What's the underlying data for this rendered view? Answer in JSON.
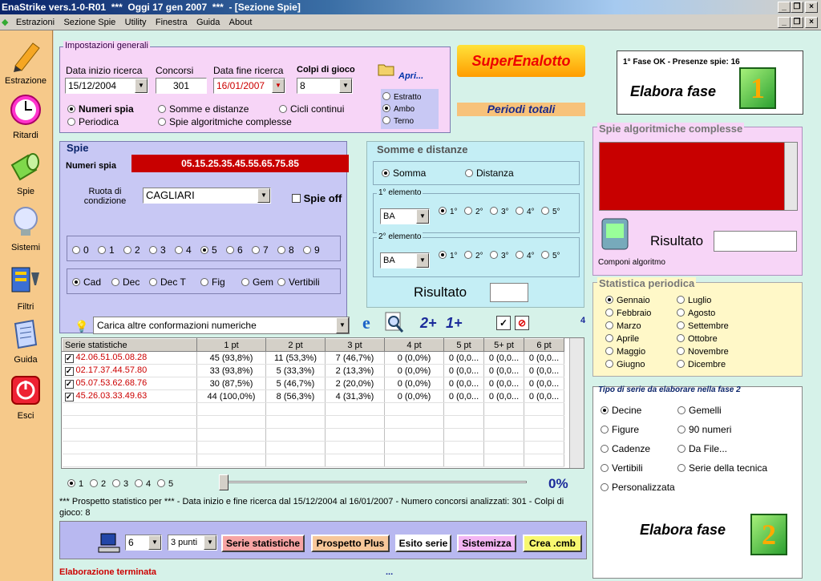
{
  "window": {
    "title": "EnaStrike vers.1-0-R01  ***  Oggi 17 gen 2007  ***  - [Sezione Spie]"
  },
  "menu": [
    "Estrazioni",
    "Sezione Spie",
    "Utility",
    "Finestra",
    "Guida",
    "About"
  ],
  "sidebar": [
    {
      "label": "Estrazione",
      "icon": "pencil-icon"
    },
    {
      "label": "Ritardi",
      "icon": "clock-icon"
    },
    {
      "label": "Spie",
      "icon": "flashlight-icon"
    },
    {
      "label": "Sistemi",
      "icon": "lightbulb-icon"
    },
    {
      "label": "Filtri",
      "icon": "filter-icon"
    },
    {
      "label": "Guida",
      "icon": "book-icon"
    },
    {
      "label": "Esci",
      "icon": "power-icon"
    }
  ],
  "impostazioni": {
    "legend": "Impostazioni generali",
    "data_inizio_label": "Data inizio ricerca",
    "data_inizio": "15/12/2004",
    "concorsi_label": "Concorsi",
    "concorsi": "301",
    "data_fine_label": "Data fine ricerca",
    "data_fine": "16/01/2007",
    "colpi_label": "Colpi di gioco",
    "colpi": "8",
    "apri": "Apri...",
    "options": [
      "Numeri spia",
      "Somme e distanze",
      "Cicli continui",
      "Periodica",
      "Spie algoritmiche complesse"
    ],
    "selected": "Numeri spia",
    "tipo": [
      "Estratto",
      "Ambo",
      "Terno"
    ],
    "tipo_selected": "Ambo"
  },
  "logo": {
    "text": "SuperEnalotto",
    "periodi": "Periodi totali"
  },
  "fase1": {
    "status": "1° Fase OK - Presenze spie: 16",
    "label": "Elabora fase",
    "num": "1"
  },
  "spie": {
    "legend": "Spie",
    "numeri_label": "Numeri spia",
    "numeri": "05.15.25.35.45.55.65.75.85",
    "ruota_label": "Ruota di condizione",
    "ruota": "CAGLIARI",
    "spie_off": "Spie off",
    "digits": [
      "0",
      "1",
      "2",
      "3",
      "4",
      "5",
      "6",
      "7",
      "8",
      "9"
    ],
    "digit_selected": "5",
    "tipi": [
      "Cad",
      "Dec",
      "Dec T",
      "Fig",
      "Gem",
      "Vertibili"
    ],
    "tipo_selected": "Cad",
    "carica": "Carica altre conformazioni numeriche"
  },
  "somme": {
    "legend": "Somme e distanze",
    "somma": "Somma",
    "distanza": "Distanza",
    "el1": "1° elemento",
    "el2": "2° elemento",
    "ruota1": "BA",
    "ruota2": "BA",
    "pos": [
      "1°",
      "2°",
      "3°",
      "4°",
      "5°"
    ],
    "risultato": "Risultato"
  },
  "toolbar": {
    "two_plus": "2+",
    "one_plus": "1+",
    "count": "4"
  },
  "algo": {
    "legend": "Spie algoritmiche complesse",
    "risultato": "Risultato",
    "componi": "Componi algoritmo"
  },
  "periodica": {
    "legend": "Statistica periodica",
    "months": [
      "Gennaio",
      "Febbraio",
      "Marzo",
      "Aprile",
      "Maggio",
      "Giugno",
      "Luglio",
      "Agosto",
      "Settembre",
      "Ottobre",
      "Novembre",
      "Dicembre"
    ],
    "selected": "Gennaio"
  },
  "tiposerie": {
    "legend": "Tipo di serie da elaborare nella fase 2",
    "options": [
      "Decine",
      "Gemelli",
      "Figure",
      "90 numeri",
      "Cadenze",
      "Da File...",
      "Vertibili",
      "Serie della tecnica",
      "Personalizzata"
    ],
    "selected": "Decine"
  },
  "fase2": {
    "label": "Elabora fase",
    "num": "2"
  },
  "table": {
    "headers": [
      "Serie statistiche",
      "1 pt",
      "2 pt",
      "3 pt",
      "4 pt",
      "5 pt",
      "5+ pt",
      "6 pt"
    ],
    "rows": [
      [
        "42.06.51.05.08.28",
        "45 (93,8%)",
        "11 (53,3%)",
        "7 (46,7%)",
        "0 (0,0%)",
        "0 (0,0...",
        "0 (0,0...",
        "0 (0,0..."
      ],
      [
        "02.17.37.44.57.80",
        "33 (93,8%)",
        "5 (33,3%)",
        "2 (13,3%)",
        "0 (0,0%)",
        "0 (0,0...",
        "0 (0,0...",
        "0 (0,0..."
      ],
      [
        "05.07.53.62.68.76",
        "30 (87,5%)",
        "5 (46,7%)",
        "2 (20,0%)",
        "0 (0,0%)",
        "0 (0,0...",
        "0 (0,0...",
        "0 (0,0..."
      ],
      [
        "45.26.03.33.49.63",
        "44 (100,0%)",
        "8 (56,3%)",
        "4 (31,3%)",
        "0 (0,0%)",
        "0 (0,0...",
        "0 (0,0...",
        "0 (0,0..."
      ]
    ]
  },
  "progress": {
    "options": [
      "1",
      "2",
      "3",
      "4",
      "5"
    ],
    "selected": "1",
    "percent": "0%"
  },
  "prospetto": "*** Prospetto statistico per  ***  - Data inizio e fine ricerca dal 15/12/2004 al 16/01/2007 - Numero concorsi analizzati: 301 - Colpi di gioco: 8",
  "bottom": {
    "num": "6",
    "punti": "3 punti",
    "buttons": [
      "Serie statistiche",
      "Prospetto Plus",
      "Esito serie",
      "Sistemizza",
      "Crea .cmb"
    ]
  },
  "status": {
    "text": "Elaborazione terminata",
    "dots": "..."
  }
}
